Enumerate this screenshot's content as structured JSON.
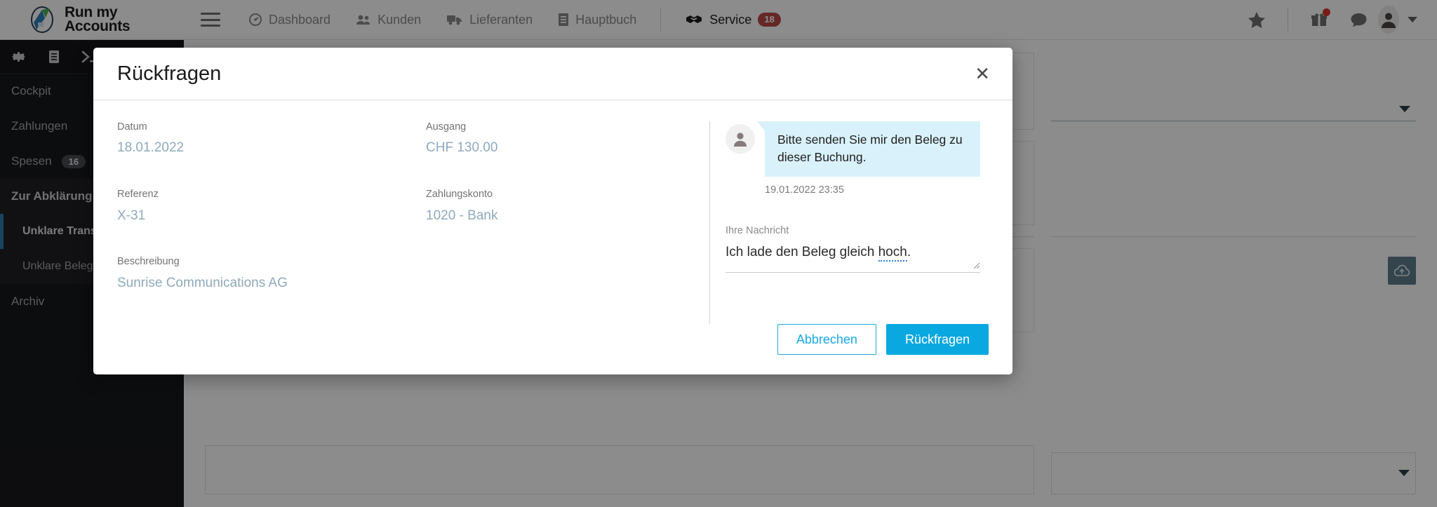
{
  "topnav": {
    "brand_line1": "Run my",
    "brand_line2": "Accounts",
    "menu_icon": "hamburger-icon",
    "items": [
      {
        "label": "Dashboard",
        "icon": "dashboard-icon"
      },
      {
        "label": "Kunden",
        "icon": "customers-icon"
      },
      {
        "label": "Lieferanten",
        "icon": "truck-icon"
      },
      {
        "label": "Hauptbuch",
        "icon": "book-icon"
      }
    ],
    "service": {
      "label": "Service",
      "icon": "handshake-icon",
      "badge": "18"
    },
    "right_icons": [
      {
        "name": "star-icon"
      },
      {
        "name": "gift-icon",
        "has_dot": true
      },
      {
        "name": "chat-icon"
      },
      {
        "name": "avatar-icon"
      }
    ]
  },
  "sidebar": {
    "tools": [
      {
        "name": "gear-icon"
      },
      {
        "name": "book-icon"
      },
      {
        "name": "terminal-icon"
      }
    ],
    "items": [
      {
        "label": "Cockpit",
        "badge": "",
        "level": "top",
        "active": false
      },
      {
        "label": "Zahlungen",
        "badge": "",
        "level": "top",
        "active": false
      },
      {
        "label": "Spesen",
        "badge": "16",
        "level": "top",
        "active": false
      },
      {
        "label": "Zur Abklärung",
        "badge": "",
        "level": "group",
        "active": false
      },
      {
        "label": "Unklare Transaktionen",
        "badge": "",
        "level": "sub",
        "active": true
      },
      {
        "label": "Unklare Belege",
        "badge": "",
        "level": "sub",
        "active": false
      },
      {
        "label": "Archiv",
        "badge": "",
        "level": "top",
        "active": false
      }
    ]
  },
  "modal": {
    "title": "Rückfragen",
    "close_icon": "close-icon",
    "fields_left": [
      {
        "label": "Datum",
        "value": "18.01.2022"
      },
      {
        "label": "Referenz",
        "value": "X-31"
      },
      {
        "label": "Beschreibung",
        "value": "Sunrise Communications AG"
      }
    ],
    "fields_mid": [
      {
        "label": "Ausgang",
        "value": "CHF 130.00"
      },
      {
        "label": "Zahlungskonto",
        "value": "1020 - Bank"
      }
    ],
    "conversation": {
      "avatar_icon": "user-avatar-icon",
      "message": "Bitte senden Sie mir den Beleg zu dieser Buchung.",
      "timestamp": "19.01.2022 23:35"
    },
    "reply": {
      "label": "Ihre Nachricht",
      "value_before": "Ich lade den Beleg gleich ",
      "value_spell": "hoch",
      "value_after": ".",
      "placeholder": "",
      "resize_icon": "resize-grip-icon"
    },
    "buttons": {
      "cancel": "Abbrechen",
      "submit": "Rückfragen"
    }
  },
  "colors": {
    "accent": "#0aa8e0",
    "accent_outline": "#19a9e4",
    "bubble": "#d9f1fa",
    "value_text": "#8fa9bb",
    "sidebar_bg": "#17181c",
    "badge_red": "#b94a48",
    "sidebar_active_border": "#2b7fae"
  }
}
